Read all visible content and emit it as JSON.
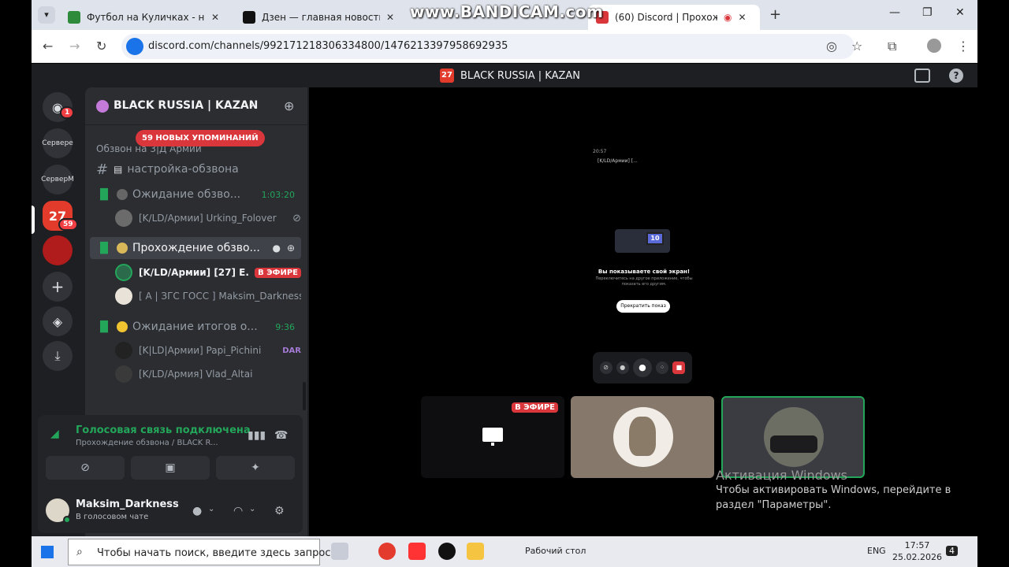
{
  "browser": {
    "tabs": [
      {
        "title": "Футбол на Куличках - новости",
        "active": false
      },
      {
        "title": "Дзен — главная новостная ин",
        "active": false
      },
      {
        "title": "(60) Discord | Прохожд",
        "active": true
      }
    ],
    "watermark": "www.BANDICAM.com",
    "url": "discord.com/channels/992171218306334800/1476213397958692935"
  },
  "discord": {
    "window_title": "BLACK RUSSIA | KAZAN",
    "guilds": [
      {
        "label": "Сервере"
      },
      {
        "label": "СерверМ"
      }
    ],
    "dm_badge": "1",
    "guild_badge": "59",
    "server_name": "BLACK RUSSIA | KAZAN",
    "mentions_banner": "59 НОВЫХ УПОМИНАНИЙ",
    "category": "Обзвон на 3|Д Армии",
    "channels": [
      {
        "name": "настройка-обзвона",
        "type": "text"
      },
      {
        "name": "Ожидание обзво...",
        "type": "voice",
        "timer": "1:03:20"
      },
      {
        "name": "Прохождение обзво...",
        "type": "voice",
        "active": true
      },
      {
        "name": "Ожидание итогов о...",
        "type": "voice",
        "timer": "9:36"
      }
    ],
    "users": {
      "waiting": [
        {
          "name": "[K/LD/Армии] Urking_Folover"
        }
      ],
      "passing": [
        {
          "name": "[K/LD/Армии] [27] E...",
          "live": "В ЭФИРЕ"
        },
        {
          "name": "[ А | ЗГС ГОСС ] Maksim_Darkness"
        }
      ],
      "results": [
        {
          "name": "[K|LD|Армии] Papi_Pichini",
          "tag": "DAR"
        },
        {
          "name": "[K/LD/Армия] Vlad_Altai"
        }
      ]
    },
    "voice": {
      "status": "Голосовая связь подключена",
      "channel": "Прохождение обзвона / BLACK R..."
    },
    "me": {
      "name": "Maksim_Darkness",
      "status": "В голосовом чате"
    },
    "stream_preview": {
      "time": "20:57",
      "channel": "[K/LD/Армии] [...",
      "badge": "10",
      "heading": "Вы показываете свой экран!",
      "sub": "Переключитесь на другое приложение, чтобы показать его другим.",
      "stop_button": "Прекратить показ"
    },
    "tiles": [
      {
        "live": "В ЭФИРЕ"
      },
      {},
      {}
    ]
  },
  "windows_activation": {
    "title": "Активация Windows",
    "line1": "Чтобы активировать Windows, перейдите в",
    "line2": "раздел \"Параметры\"."
  },
  "taskbar": {
    "search_placeholder": "Чтобы начать поиск, введите здесь запрос",
    "desktop_label": "Рабочий стол",
    "lang": "ENG",
    "time": "17:57",
    "date": "25.02.2026",
    "notif_count": "4"
  }
}
